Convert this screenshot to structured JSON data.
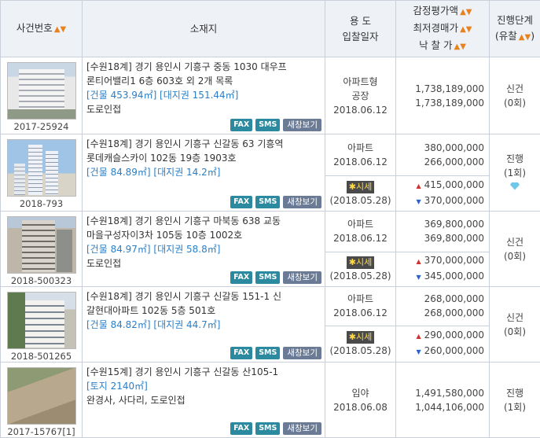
{
  "header": {
    "case_no": "사건번호",
    "address": "소재지",
    "usage_line1": "용 도",
    "usage_line2": "입찰일자",
    "price_line1": "감정평가액",
    "price_line2": "최저경매가",
    "price_line3": "낙 찰 가",
    "stage_line1": "진행단계",
    "stage_line2": "(유찰",
    "stage_line2_end": ")",
    "sort_icon": "sort-updown-icon"
  },
  "buttons": {
    "fax": "FAX",
    "sms": "SMS",
    "new_window": "새창보기"
  },
  "market": {
    "label": "시세"
  },
  "rows": [
    {
      "case_no": "2017-25924",
      "addr_line1": "[수원18계] 경기 용인시 기흥구 중동 1030 대우프",
      "addr_line2": "론티어밸리1 6층 603호 외 2개 목록",
      "area_line": "[건물 453.94㎡] [대지권 151.44㎡]",
      "note": "도로인접",
      "usage": "아파트형",
      "usage2": "공장",
      "date": "2018.06.12",
      "appraisal": "1,738,189,000",
      "minimum": "1,738,189,000",
      "stage": "신건",
      "fail_count": "(0회)"
    },
    {
      "case_no": "2018-793",
      "addr_line1": "[수원18계] 경기 용인시 기흥구 신갈동 63 기흥역",
      "addr_line2": "롯데캐슬스카이 102동 19층 1903호",
      "area_line": "[건물 84.89㎡] [대지권 14.2㎡]",
      "note": "",
      "usage": "아파트",
      "date": "2018.06.12",
      "appraisal": "380,000,000",
      "minimum": "266,000,000",
      "market_date": "(2018.05.28)",
      "market_high": "415,000,000",
      "market_low": "370,000,000",
      "stage": "진행",
      "fail_count": "(1회)"
    },
    {
      "case_no": "2018-500323",
      "addr_line1": "[수원18계] 경기 용인시 기흥구 마북동 638 교동",
      "addr_line2": "마을구성자이3차 105동 10층 1002호",
      "area_line": "[건물 84.97㎡] [대지권 58.8㎡]",
      "note": "도로인접",
      "usage": "아파트",
      "date": "2018.06.12",
      "appraisal": "369,800,000",
      "minimum": "369,800,000",
      "market_date": "(2018.05.28)",
      "market_high": "370,000,000",
      "market_low": "345,000,000",
      "stage": "신건",
      "fail_count": "(0회)"
    },
    {
      "case_no": "2018-501265",
      "addr_line1": "[수원18계] 경기 용인시 기흥구 신갈동 151-1 신",
      "addr_line2": "갈현대아파트 102동 5층 501호",
      "area_line": "[건물 84.82㎡] [대지권 44.7㎡]",
      "note": "",
      "usage": "아파트",
      "date": "2018.06.12",
      "appraisal": "268,000,000",
      "minimum": "268,000,000",
      "market_date": "(2018.05.28)",
      "market_high": "290,000,000",
      "market_low": "260,000,000",
      "stage": "신건",
      "fail_count": "(0회)"
    },
    {
      "case_no": "2017-15767[1]",
      "addr_line1": "[수원15계] 경기 용인시 기흥구 신갈동 산105-1",
      "area_line": "[토지 2140㎡]",
      "note": "완경사, 사다리, 도로인접",
      "usage": "임야",
      "date": "2018.06.08",
      "appraisal": "1,491,580,000",
      "minimum": "1,044,106,000",
      "stage": "진행",
      "fail_count": "(1회)"
    }
  ]
}
